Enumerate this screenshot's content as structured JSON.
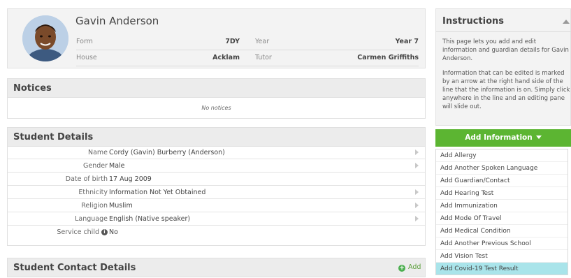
{
  "student": {
    "name": "Gavin Anderson",
    "form_label": "Form",
    "form_value": "7DY",
    "year_label": "Year",
    "year_value": "Year 7",
    "house_label": "House",
    "house_value": "Acklam",
    "tutor_label": "Tutor",
    "tutor_value": "Carmen Griffiths"
  },
  "notices": {
    "title": "Notices",
    "empty_text": "No notices"
  },
  "details": {
    "title": "Student Details",
    "rows": [
      {
        "label": "Name",
        "value": "Cordy (Gavin) Burberry (Anderson)"
      },
      {
        "label": "Gender",
        "value": "Male"
      },
      {
        "label": "Date of birth",
        "value": "17 Aug 2009"
      },
      {
        "label": "Ethnicity",
        "value": "Information Not Yet Obtained"
      },
      {
        "label": "Religion",
        "value": "Muslim"
      },
      {
        "label": "Language",
        "value": "English (Native speaker)"
      },
      {
        "label": "Service child",
        "value": "No"
      }
    ]
  },
  "contact": {
    "title": "Student Contact Details",
    "add_label": "Add"
  },
  "instructions": {
    "title": "Instructions",
    "para1": "This page lets you add and edit information and guardian details for Gavin Anderson.",
    "para2": "Information that can be edited is marked by an arrow at the right hand side of the line that the information is on. Simply click anywhere in the line and an editing pane will slide out."
  },
  "add_info": {
    "button_label": "Add Information",
    "items": [
      "Add Allergy",
      "Add Another Spoken Language",
      "Add Guardian/Contact",
      "Add Hearing Test",
      "Add Immunization",
      "Add Mode Of Travel",
      "Add Medical Condition",
      "Add Another Previous School",
      "Add Vision Test",
      "Add Covid-19 Test Result"
    ],
    "highlighted_index": 9
  },
  "colors": {
    "accent_green": "#5cb532",
    "highlight_cyan": "#a9e4ea"
  },
  "icons": [
    "triangle-up-icon",
    "caret-down-icon",
    "info-circle-icon",
    "plus-circle-icon",
    "row-arrow-icon"
  ]
}
